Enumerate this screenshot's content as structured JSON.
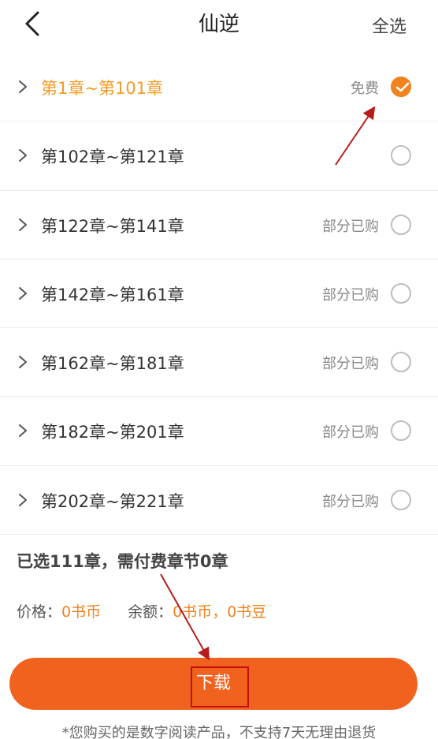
{
  "header": {
    "title": "仙逆",
    "select_all": "全选"
  },
  "chapters": [
    {
      "label": "第1章~第101章",
      "tag": "免费",
      "selected": true
    },
    {
      "label": "第102章~第121章",
      "tag": "",
      "selected": false
    },
    {
      "label": "第122章~第141章",
      "tag": "部分已购",
      "selected": false
    },
    {
      "label": "第142章~第161章",
      "tag": "部分已购",
      "selected": false
    },
    {
      "label": "第162章~第181章",
      "tag": "部分已购",
      "selected": false
    },
    {
      "label": "第182章~第201章",
      "tag": "部分已购",
      "selected": false
    },
    {
      "label": "第202章~第221章",
      "tag": "部分已购",
      "selected": false
    }
  ],
  "summary": {
    "text": "已选111章，需付费章节0章"
  },
  "price": {
    "price_label": "价格：",
    "price_value": "0书币",
    "balance_label": "余额：",
    "balance_value": "0书币，0书豆"
  },
  "download": {
    "label": "下载"
  },
  "notice": "*您购买的是数字阅读产品，不支持7天无理由退货",
  "colors": {
    "accent": "#f0831e",
    "button": "#f0621e",
    "annotation": "#c40e0e"
  },
  "icons": {
    "back": "back-arrow-icon",
    "chevron": "chevron-right-icon",
    "check": "checkmark-icon"
  }
}
